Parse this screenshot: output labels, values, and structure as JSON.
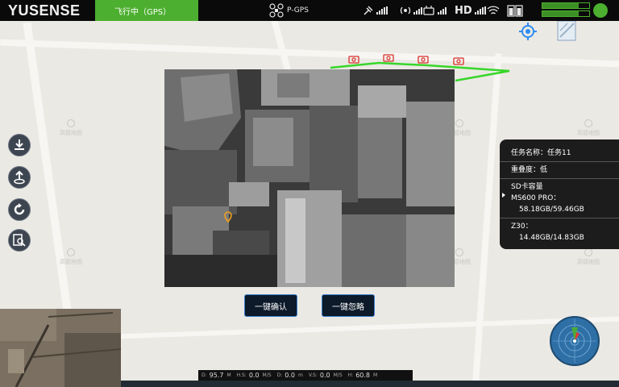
{
  "app": {
    "logo": "YUSENSE"
  },
  "topbar": {
    "flight_status": "飞行中（GPS）",
    "gps_mode": "P-GPS",
    "hd_label": "HD",
    "battery_color": "#4caf2f",
    "status_color": "#4caf2f"
  },
  "left_tools": [
    {
      "name": "download-icon"
    },
    {
      "name": "upload-route-icon"
    },
    {
      "name": "refresh-icon"
    },
    {
      "name": "search-document-icon"
    }
  ],
  "actions": {
    "confirm_label": "一键确认",
    "ignore_label": "一键忽略"
  },
  "info_panel": {
    "task_label": "任务名称：",
    "task_value": "任务11",
    "overlap_label": "重叠度：低",
    "sd_label": "SD卡容量",
    "ms600_label": "MS600 PRO：",
    "ms600_value": "58.18GB/59.46GB",
    "z30_label": "Z30：",
    "z30_value": "14.48GB/14.83GB"
  },
  "telemetry": {
    "d_label": "D:",
    "d_value": "95.7",
    "d_unit": "M",
    "hs_label": "H.S:",
    "hs_value": "0.0",
    "hs_unit": "M/S",
    "dist_label": "D:",
    "dist_value": "0.0",
    "dist_unit": "m",
    "vs_label": "V.S:",
    "vs_value": "0.0",
    "vs_unit": "M/S",
    "h_label": "H:",
    "h_value": "60.8",
    "h_unit": "M"
  },
  "map": {
    "watermark": "高德地图"
  }
}
